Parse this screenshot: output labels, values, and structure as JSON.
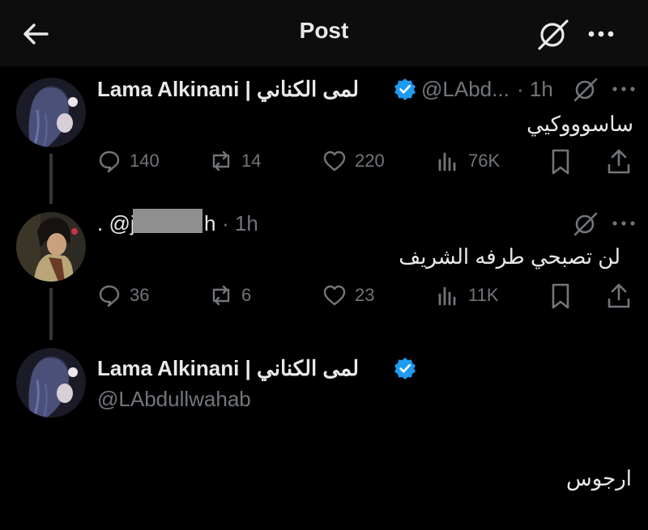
{
  "header": {
    "title": "Post"
  },
  "tweets": [
    {
      "name": "Lama Alkinani | لمى الكناني",
      "handle": "@LAbd...",
      "time": "· 1h",
      "text": "ساسوووكيي",
      "stats": {
        "replies": "140",
        "reposts": "14",
        "likes": "220",
        "views": "76K"
      }
    },
    {
      "prefix": ". @j",
      "handle_tail": "h",
      "time": "· 1h",
      "text": "لن تصبحي طرفه الشريف",
      "stats": {
        "replies": "36",
        "reposts": "6",
        "likes": "23",
        "views": "11K"
      }
    }
  ],
  "main_post": {
    "name": "Lama Alkinani | لمى الكناني",
    "handle": "@LAbdullwahab",
    "text": "ارجوس"
  },
  "colors": {
    "background": "#000000",
    "text": "#e7e9ea",
    "muted": "#71767b",
    "verified": "#1d9bf0",
    "line": "#333639"
  }
}
